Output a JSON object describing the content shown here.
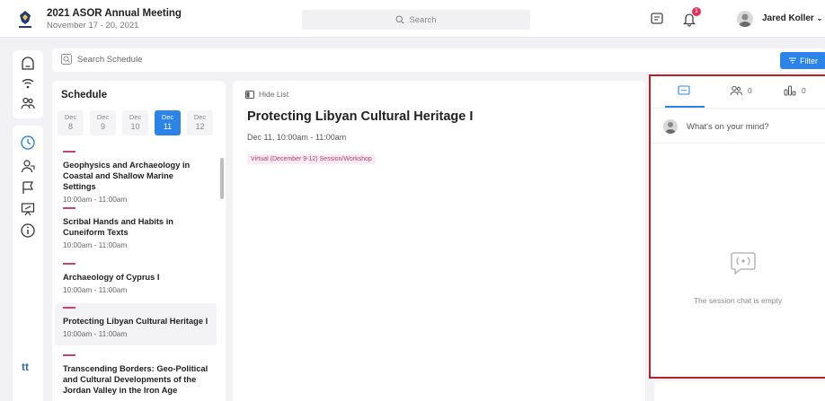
{
  "header": {
    "event_title": "2021 ASOR Annual Meeting",
    "event_dates": "November 17 - 20, 2021",
    "search_placeholder": "Search",
    "notification_count": "1",
    "user_name": "Jared Koller"
  },
  "schedule_bar": {
    "search_placeholder": "Search Schedule",
    "filter_label": "Filter"
  },
  "schedule": {
    "title": "Schedule",
    "days": [
      {
        "month": "Dec",
        "day": "8"
      },
      {
        "month": "Dec",
        "day": "9"
      },
      {
        "month": "Dec",
        "day": "10"
      },
      {
        "month": "Dec",
        "day": "11"
      },
      {
        "month": "Dec",
        "day": "12"
      }
    ],
    "sessions": [
      {
        "title": "Geophysics and Archaeology in Coastal and Shallow Marine Settings",
        "time": "10:00am - 11:00am"
      },
      {
        "title": "Scribal Hands and Habits in Cuneiform Texts",
        "time": "10:00am - 11:00am"
      },
      {
        "title": "Archaeology of Cyprus I",
        "time": "10:00am - 11:00am"
      },
      {
        "title": "Protecting Libyan Cultural Heritage I",
        "time": "10:00am - 11:00am"
      },
      {
        "title": "Transcending Borders: Geo-Political and Cultural Developments of the Jordan Valley in the Iron Age",
        "time": ""
      }
    ]
  },
  "detail": {
    "hide_list_label": "Hide List",
    "title": "Protecting Libyan Cultural Heritage I",
    "datetime": "Dec 11, 10:00am - 11:00am",
    "tag": "Virtual (December 9-12) Session/Workshop"
  },
  "chat": {
    "attendee_count": "0",
    "poll_count": "0",
    "prompt": "What's on your mind?",
    "empty_text": "The session chat is empty"
  },
  "sidebar": {
    "brand_mark": "tt"
  },
  "colors": {
    "accent": "#2c84e8",
    "session_marker": "#c2447a",
    "highlight_border": "#b3232e",
    "notification": "#e0335b"
  }
}
